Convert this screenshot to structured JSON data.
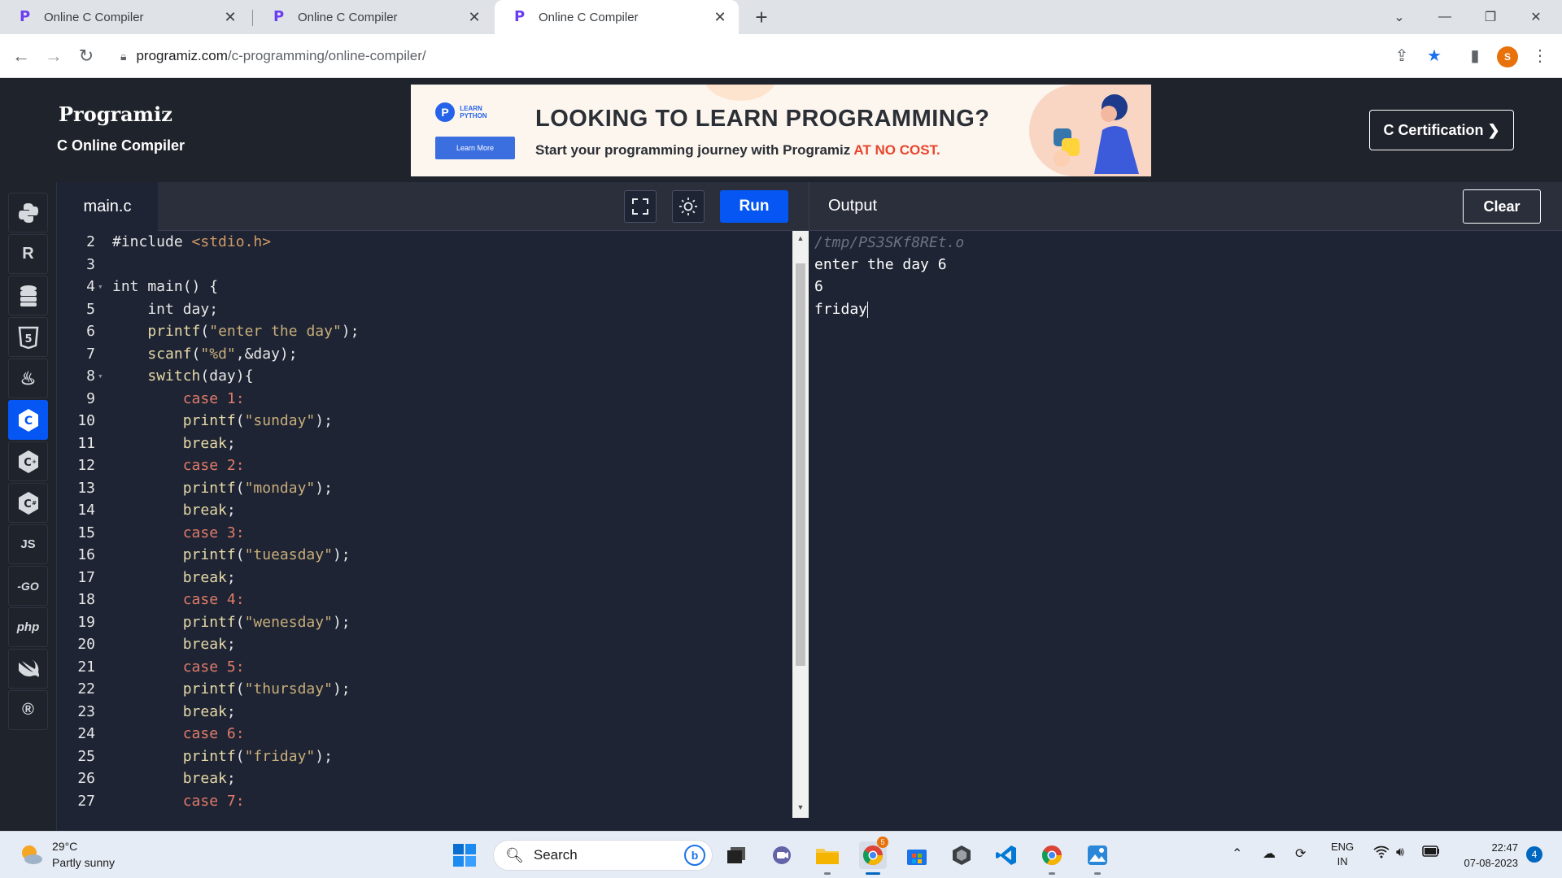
{
  "browser": {
    "tabs": [
      {
        "title": "Online C Compiler",
        "active": false
      },
      {
        "title": "Online C Compiler",
        "active": false
      },
      {
        "title": "Online C Compiler",
        "active": true
      }
    ],
    "new_tab_label": "+",
    "url_host": "programiz.com",
    "url_path": "/c-programming/online-compiler/",
    "profile_initial": "S"
  },
  "site": {
    "logo": "Programiz",
    "subtitle": "C Online Compiler",
    "certification_button": "C Certification ❯"
  },
  "banner": {
    "badge_line1": "LEARN",
    "badge_line2": "PYTHON",
    "button": "Learn More",
    "headline": "LOOKING TO LEARN PROGRAMMING?",
    "sub_text": "Start your programming journey with Programiz ",
    "sub_accent": "AT NO COST."
  },
  "languages": [
    "python",
    "r",
    "sql",
    "html",
    "java",
    "c",
    "c++",
    "c#",
    "js",
    "go",
    "php",
    "swift",
    "rust"
  ],
  "language_labels": {
    "js": "JS",
    "go": "-GO",
    "php": "php"
  },
  "editor": {
    "filename": "main.c",
    "run_label": "Run",
    "lines": [
      {
        "n": "2",
        "code": "#include <stdio.h>"
      },
      {
        "n": "3",
        "code": ""
      },
      {
        "n": "4",
        "code": "int main() {"
      },
      {
        "n": "5",
        "code": "    int day;"
      },
      {
        "n": "6",
        "code": "    printf(\"enter the day\");"
      },
      {
        "n": "7",
        "code": "    scanf(\"%d\",&day);"
      },
      {
        "n": "8",
        "code": "    switch(day){"
      },
      {
        "n": "9",
        "code": "        case 1:"
      },
      {
        "n": "10",
        "code": "        printf(\"sunday\");"
      },
      {
        "n": "11",
        "code": "        break;"
      },
      {
        "n": "12",
        "code": "        case 2:"
      },
      {
        "n": "13",
        "code": "        printf(\"monday\");"
      },
      {
        "n": "14",
        "code": "        break;"
      },
      {
        "n": "15",
        "code": "        case 3:"
      },
      {
        "n": "16",
        "code": "        printf(\"tueasday\");"
      },
      {
        "n": "17",
        "code": "        break;"
      },
      {
        "n": "18",
        "code": "        case 4:"
      },
      {
        "n": "19",
        "code": "        printf(\"wenesday\");"
      },
      {
        "n": "20",
        "code": "        break;"
      },
      {
        "n": "21",
        "code": "        case 5:"
      },
      {
        "n": "22",
        "code": "        printf(\"thursday\");"
      },
      {
        "n": "23",
        "code": "        break;"
      },
      {
        "n": "24",
        "code": "        case 6:"
      },
      {
        "n": "25",
        "code": "        printf(\"friday\");"
      },
      {
        "n": "26",
        "code": "        break;"
      },
      {
        "n": "27",
        "code": "        case 7:"
      }
    ]
  },
  "output": {
    "title": "Output",
    "clear_label": "Clear",
    "path_line": "/tmp/PS3SKf8REt.o",
    "lines": [
      "enter the day 6",
      "6",
      "friday"
    ]
  },
  "taskbar": {
    "temperature": "29°C",
    "weather": "Partly sunny",
    "search_placeholder": "Search",
    "language_line1": "ENG",
    "language_line2": "IN",
    "time": "22:47",
    "date": "07-08-2023",
    "notification_count": "4",
    "chrome_badge": "5"
  },
  "colors": {
    "accent": "#0556f3",
    "editor_bg": "#1e2433",
    "header_bg": "#1f232b"
  }
}
